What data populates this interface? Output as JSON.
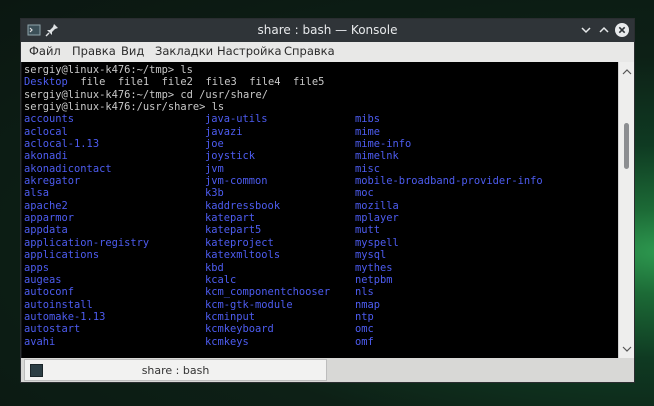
{
  "window": {
    "title": "share : bash — Konsole",
    "icons": [
      "terminal-icon",
      "pin-icon",
      "minimize-icon",
      "maximize-icon",
      "close-icon"
    ]
  },
  "menu": [
    "Файл",
    "Правка",
    "Вид",
    "Закладки",
    "Настройка",
    "Справка"
  ],
  "terminal": {
    "prompt1": "sergiy@linux-k476:~/tmp> ls",
    "ls_output": [
      "Desktop",
      "file",
      "file1",
      "file2",
      "file3",
      "file4",
      "file5"
    ],
    "prompt2": "sergiy@linux-k476:~/tmp> cd /usr/share/",
    "prompt3": "sergiy@linux-k476:/usr/share> ls",
    "col1": [
      "accounts",
      "aclocal",
      "aclocal-1.13",
      "akonadi",
      "akonadicontact",
      "akregator",
      "alsa",
      "apache2",
      "apparmor",
      "appdata",
      "application-registry",
      "applications",
      "apps",
      "augeas",
      "autoconf",
      "autoinstall",
      "automake-1.13",
      "autostart",
      "avahi"
    ],
    "col2": [
      "java-utils",
      "javazi",
      "joe",
      "joystick",
      "jvm",
      "jvm-common",
      "k3b",
      "kaddressbook",
      "katepart",
      "katepart5",
      "kateproject",
      "katexmltools",
      "kbd",
      "kcalc",
      "kcm_componentchooser",
      "kcm-gtk-module",
      "kcminput",
      "kcmkeyboard",
      "kcmkeys"
    ],
    "col3": [
      "mibs",
      "mime",
      "mime-info",
      "mimelnk",
      "misc",
      "mobile-broadband-provider-info",
      "moc",
      "mozilla",
      "mplayer",
      "mutt",
      "myspell",
      "mysql",
      "mythes",
      "netpbm",
      "nls",
      "nmap",
      "ntp",
      "omc",
      "omf"
    ]
  },
  "tab": {
    "label": "share : bash"
  },
  "colors": {
    "directory": "#4d5cf0",
    "text": "#c9c9c9",
    "terminal_bg": "#000000",
    "titlebar": "#2f3438",
    "menubar": "#e8e8e7"
  }
}
